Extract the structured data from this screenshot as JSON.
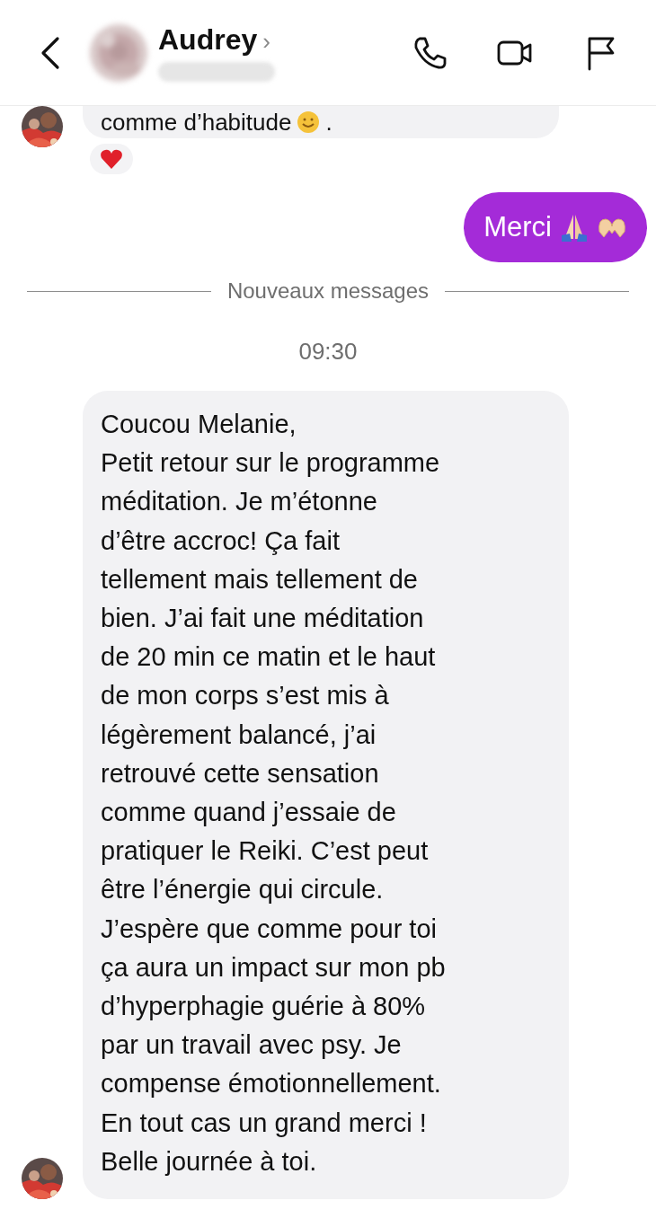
{
  "header": {
    "contact_name": "Audrey",
    "chevron": "›"
  },
  "messages": [
    {
      "kind": "received_partial",
      "text_before": "comme d’habitude",
      "text_after": ".",
      "reaction": true
    },
    {
      "kind": "sent",
      "text": "Merci"
    },
    {
      "kind": "divider",
      "text": "Nouveaux messages"
    },
    {
      "kind": "time",
      "text": "09:30"
    },
    {
      "kind": "received",
      "lines": [
        "Coucou Melanie,",
        "Petit retour sur le programme",
        "méditation. Je m’étonne",
        "d’être accroc! Ça fait",
        "tellement mais tellement de",
        "bien. J’ai fait une méditation",
        "de 20 min ce matin et le haut",
        "de mon corps s’est mis à",
        "légèrement balancé, j’ai",
        "retrouvé cette sensation",
        "comme quand j’essaie de",
        "pratiquer le Reiki. C’est peut",
        "être l’énergie qui circule.",
        "J’espère que comme pour toi",
        "ça aura un impact sur mon pb",
        "d’hyperphagie guérie à 80%",
        "par un travail avec psy. Je",
        "compense émotionnellement.",
        "En tout cas un grand merci !",
        "Belle journée à toi."
      ]
    }
  ]
}
